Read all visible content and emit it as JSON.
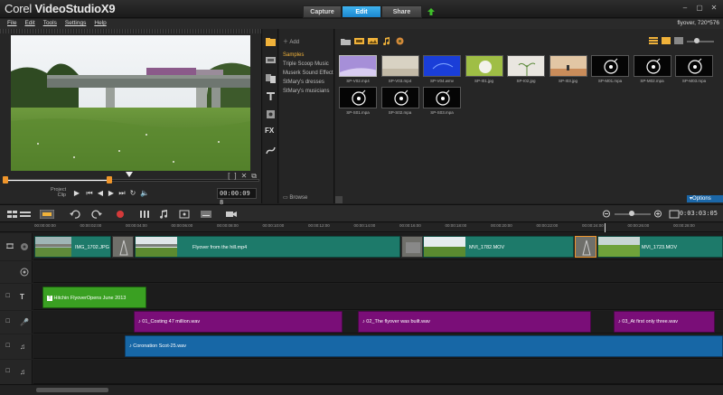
{
  "app": {
    "logo_prefix": "Corel",
    "logo_main": "VideoStudio",
    "logo_suffix": "X9",
    "project_info": "flyover, 720*576"
  },
  "tabs": [
    {
      "label": "Capture"
    },
    {
      "label": "Edit"
    },
    {
      "label": "Share"
    }
  ],
  "menu": [
    "File",
    "Edit",
    "Tools",
    "Settings",
    "Help"
  ],
  "player": {
    "project_label": "Project",
    "clip_label": "Clip",
    "timecode": "00:00:09",
    "timecode_suffix": "8",
    "mark_in": "[",
    "mark_out": "]"
  },
  "library": {
    "add_label": "Add",
    "browse_label": "Browse",
    "options_label": "Options",
    "folders": [
      "Samples",
      "Triple Scoop Music",
      "Muserk Sound Effect",
      "StMary's dresses",
      "StMary's musicians"
    ],
    "thumbnails": [
      {
        "caption": "SP-V02.mp4",
        "kind": "video-purple"
      },
      {
        "caption": "SP-V03.mp4",
        "kind": "video-beige"
      },
      {
        "caption": "SP-V04.wmv",
        "kind": "video-blue"
      },
      {
        "caption": "SP-I01.jpg",
        "kind": "img-dandelion"
      },
      {
        "caption": "SP-I02.jpg",
        "kind": "img-plant"
      },
      {
        "caption": "SP-I03.jpg",
        "kind": "img-desert"
      },
      {
        "caption": "SP-M01.mpa",
        "kind": "music"
      },
      {
        "caption": "SP-M02.mpa",
        "kind": "music"
      },
      {
        "caption": "SP-M03.mpa",
        "kind": "music"
      },
      {
        "caption": "SP-S01.mpa",
        "kind": "music"
      },
      {
        "caption": "SP-S02.mpa",
        "kind": "music"
      },
      {
        "caption": "SP-S03.mpa",
        "kind": "music"
      }
    ]
  },
  "timeline": {
    "timecode": "0:03:03:05",
    "ruler": [
      "00:00:00:00",
      "00:00:02:00",
      "00:00:04:00",
      "00:00:06:00",
      "00:00:08:00",
      "00:00:10:00",
      "00:00:12:00",
      "00:00:14:00",
      "00:00:16:00",
      "00:00:18:00",
      "00:00:20:00",
      "00:00:22:00",
      "00:00:24:00",
      "00:00:26:00",
      "00:00:28:00"
    ],
    "video_clips": [
      {
        "label": "IMG_1702.JPG"
      },
      {
        "label": "Flyover from the hill.mp4"
      },
      {
        "label": "MVI_1782.MOV"
      },
      {
        "label": "MVI_1723.MOV"
      }
    ],
    "title_clip": "Hitchin FlyoverOpens June 2013",
    "voice_clips": [
      {
        "label": "01_Costing 47 million.wav"
      },
      {
        "label": "02_The flyover was built.wav"
      },
      {
        "label": "03_At first only three.wav"
      }
    ],
    "music_clip": "Coronation Scot-25.wav"
  },
  "colors": {
    "accent_blue": "#1b86cf",
    "video_clip": "#1d7a6a",
    "title_clip": "#3aa022",
    "voice_clip": "#7a0e78",
    "music_clip": "#1767a6",
    "handle_orange": "#f0962b"
  }
}
